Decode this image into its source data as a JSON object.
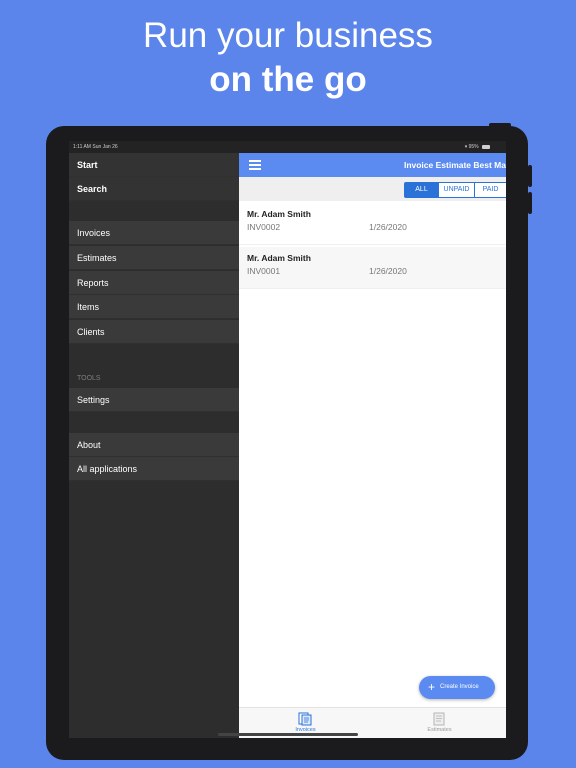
{
  "promo": {
    "line1": "Run your business",
    "line2": "on the go"
  },
  "status_bar": {
    "time_date": "1:11 AM   Sun Jan 26",
    "battery": "95%"
  },
  "drawer": {
    "top_items": [
      {
        "label": "Start"
      },
      {
        "label": "Search"
      }
    ],
    "items": [
      {
        "label": "Invoices"
      },
      {
        "label": "Estimates"
      },
      {
        "label": "Reports"
      },
      {
        "label": "Items"
      },
      {
        "label": "Clients"
      }
    ],
    "tools_header": "TOOLS",
    "tools_items": [
      {
        "label": "Settings"
      }
    ],
    "other_items": [
      {
        "label": "About"
      },
      {
        "label": "All applications"
      }
    ]
  },
  "navbar": {
    "title": "Invoice  Estimate Best Ma"
  },
  "filter": {
    "segments": [
      "ALL",
      "UNPAID",
      "PAID"
    ],
    "selected": "ALL"
  },
  "invoices": [
    {
      "client": "Mr. Adam Smith",
      "number": "INV0002",
      "date": "1/26/2020"
    },
    {
      "client": "Mr. Adam Smith",
      "number": "INV0001",
      "date": "1/26/2020"
    }
  ],
  "fab": {
    "label": "Create Invoice"
  },
  "tabbar": {
    "tabs": [
      {
        "label": "Invoices",
        "icon": "invoices-icon",
        "active": true
      },
      {
        "label": "Estimates",
        "icon": "estimates-icon",
        "active": false
      }
    ]
  },
  "colors": {
    "background": "#5b85ea",
    "accent": "#5b8af0",
    "segment_blue": "#2b72d8",
    "drawer": "#2d2d2d"
  }
}
